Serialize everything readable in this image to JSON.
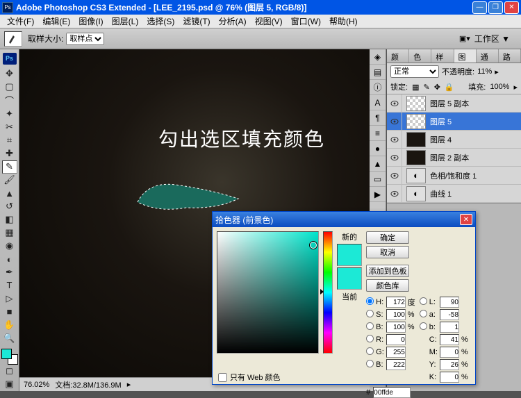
{
  "titlebar": {
    "app": "Adobe Photoshop CS3 Extended",
    "doc": "[LEE_2195.psd @ 76% (图层 5, RGB/8)]"
  },
  "menu": [
    "文件(F)",
    "编辑(E)",
    "图像(I)",
    "图层(L)",
    "选择(S)",
    "滤镜(T)",
    "分析(A)",
    "视图(V)",
    "窗口(W)",
    "帮助(H)"
  ],
  "options": {
    "sample_label": "取样大小:",
    "sample_value": "取样点",
    "workspace": "工作区 ▼"
  },
  "canvas": {
    "overlay": "勾出选区填充颜色"
  },
  "status": {
    "zoom": "76.02%",
    "docinfo": "文档:32.8M/136.9M"
  },
  "panels": {
    "tabs_small": [
      "颜色",
      "色板",
      "样式"
    ],
    "tabs_layers": [
      "图层",
      "通道",
      "路径"
    ],
    "blend_mode": "正常",
    "opacity_label": "不透明度:",
    "opacity_value": "11%",
    "lock_label": "锁定:",
    "fill_label": "填充:",
    "fill_value": "100%",
    "layers": [
      {
        "name": "图层 5 副本",
        "active": false,
        "thumb": "trans"
      },
      {
        "name": "图层 5",
        "active": true,
        "thumb": "trans"
      },
      {
        "name": "图层 4",
        "active": false,
        "thumb": "dark"
      },
      {
        "name": "图层 2 副本",
        "active": false,
        "thumb": "dark"
      },
      {
        "name": "色相/饱和度 1",
        "active": false,
        "thumb": "adj"
      },
      {
        "name": "曲线 1",
        "active": false,
        "thumb": "adj"
      }
    ]
  },
  "picker": {
    "title": "拾色器 (前景色)",
    "new_label": "新的",
    "current_label": "当前",
    "ok": "确定",
    "cancel": "取消",
    "add_swatch": "添加到色板",
    "libraries": "颜色库",
    "only_web": "只有 Web 颜色",
    "H": "172",
    "H_unit": "度",
    "S": "100",
    "S_unit": "%",
    "Bv": "100",
    "Bv_unit": "%",
    "R": "0",
    "G": "255",
    "B": "222",
    "L": "90",
    "a": "-58",
    "b_lab": "1",
    "C": "41",
    "C_unit": "%",
    "M": "0",
    "M_unit": "%",
    "Y": "26",
    "Y_unit": "%",
    "K": "0",
    "K_unit": "%",
    "hex_label": "#",
    "hex": "00ffde"
  }
}
